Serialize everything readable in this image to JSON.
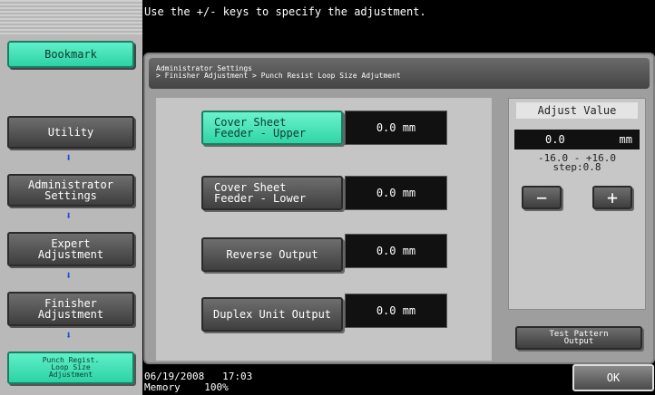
{
  "header": {
    "message": "Use the +/- keys to specify the adjustment."
  },
  "sidebar": {
    "bookmark_label": "Bookmark",
    "items": [
      {
        "label": "Utility"
      },
      {
        "label": "Administrator\nSettings"
      },
      {
        "label": "Expert\nAdjustment"
      },
      {
        "label": "Finisher\nAdjustment"
      },
      {
        "label": "Punch Regist.\nLoop Size\nAdjustment"
      }
    ],
    "arrow_glyph": "⬇"
  },
  "breadcrumb": {
    "line1": "Administrator Settings",
    "line2": "> Finisher Adjustment > Punch Resist Loop Size Adjutment"
  },
  "items": [
    {
      "label": "Cover Sheet\nFeeder - Upper",
      "value": "0.0 mm"
    },
    {
      "label": "Cover Sheet\nFeeder - Lower",
      "value": "0.0 mm"
    },
    {
      "label": "Reverse Output",
      "value": "0.0 mm"
    },
    {
      "label": "Duplex Unit Output",
      "value": "0.0 mm"
    }
  ],
  "adjust": {
    "title": "Adjust Value",
    "value": "0.0",
    "unit": "mm",
    "range": "-16.0  -  +16.0",
    "step": "step:0.8",
    "minus_label": "−",
    "plus_label": "+"
  },
  "test_pattern_label": "Test Pattern\nOutput",
  "footer": {
    "date": "06/19/2008",
    "time": "17:03",
    "memory_label": "Memory",
    "memory_value": "100%"
  },
  "ok_label": "OK",
  "colors": {
    "accent": "#3fe0b4",
    "panel": "#9e9e9e"
  }
}
